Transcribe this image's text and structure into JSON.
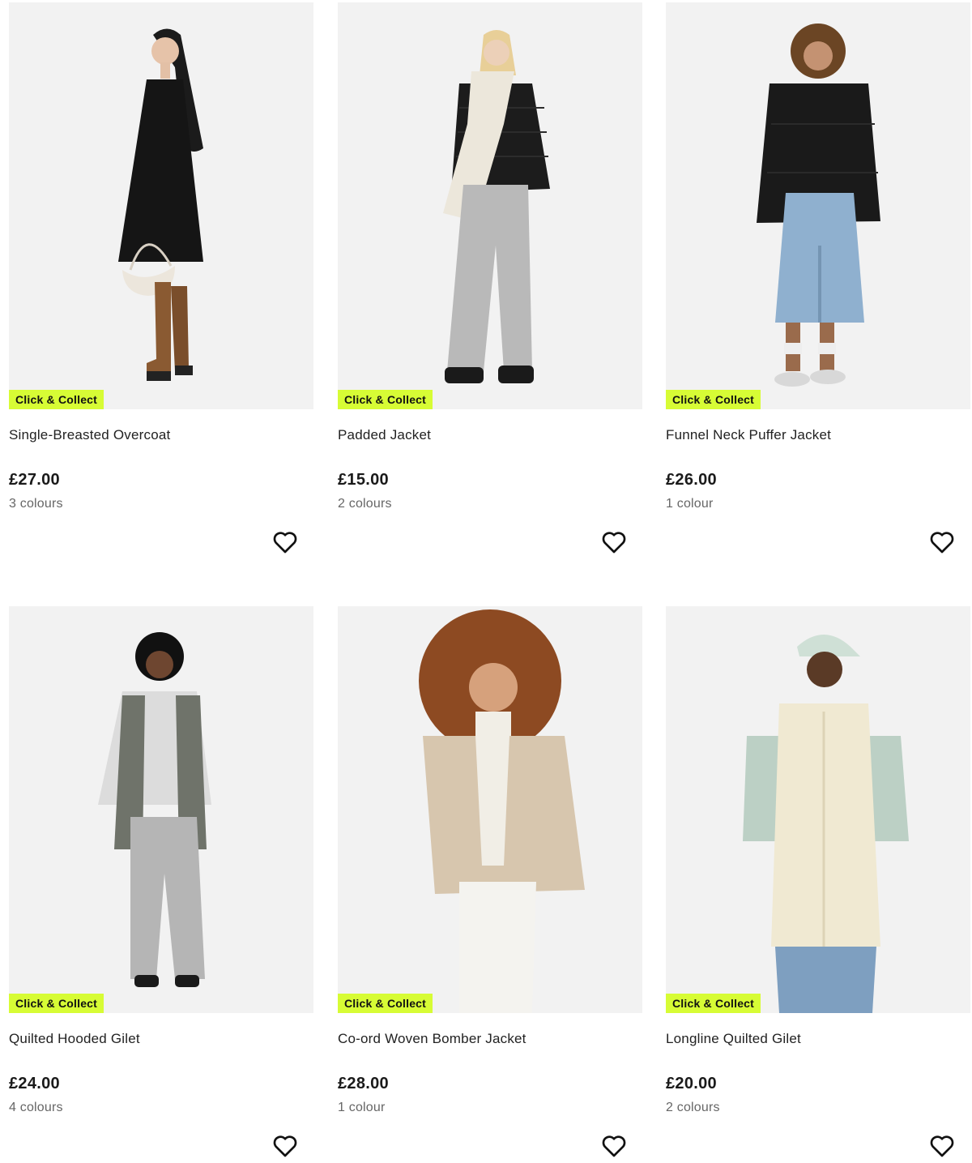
{
  "products": [
    {
      "name": "Single-Breasted Overcoat",
      "price": "£27.00",
      "colours": "3 colours",
      "badge": "Click & Collect"
    },
    {
      "name": "Padded Jacket",
      "price": "£15.00",
      "colours": "2 colours",
      "badge": "Click & Collect"
    },
    {
      "name": "Funnel Neck Puffer Jacket",
      "price": "£26.00",
      "colours": "1 colour",
      "badge": "Click & Collect"
    },
    {
      "name": "Quilted Hooded Gilet",
      "price": "£24.00",
      "colours": "4 colours",
      "badge": "Click & Collect"
    },
    {
      "name": "Co-ord Woven Bomber Jacket",
      "price": "£28.00",
      "colours": "1 colour",
      "badge": "Click & Collect"
    },
    {
      "name": "Longline Quilted Gilet",
      "price": "£20.00",
      "colours": "2 colours",
      "badge": "Click & Collect"
    }
  ],
  "icons": {
    "wishlist": "heart-outline-icon"
  },
  "colors": {
    "badge_bg": "#d7fc35",
    "photo_bg": "#f2f2f2"
  }
}
